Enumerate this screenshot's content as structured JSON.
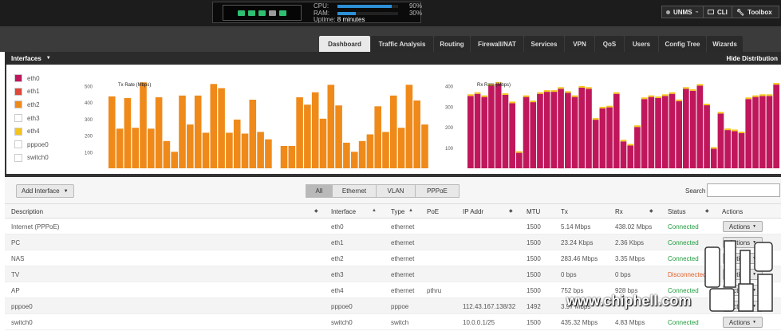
{
  "statusbox": {
    "ports": [
      "green",
      "green",
      "green",
      "grey",
      "green"
    ],
    "cpu_label": "CPU:",
    "cpu_pct": "90%",
    "cpu_value": 0.9,
    "ram_label": "RAM:",
    "ram_pct": "30%",
    "ram_value": 0.3,
    "uptime_label": "Uptime:",
    "uptime_value": "8 minutes"
  },
  "topbuttons": {
    "unms": "UNMS",
    "cli": "CLI",
    "toolbox": "Toolbox"
  },
  "tabs": [
    "Dashboard",
    "Traffic Analysis",
    "Routing",
    "Firewall/NAT",
    "Services",
    "VPN",
    "QoS",
    "Users",
    "Config Tree",
    "Wizards"
  ],
  "interfaces": {
    "title": "Interfaces",
    "hide_distribution": "Hide Distribution"
  },
  "legend": [
    {
      "name": "eth0",
      "color": "#c0175c"
    },
    {
      "name": "eth1",
      "color": "#e0483a"
    },
    {
      "name": "eth2",
      "color": "#ef8a1a"
    },
    {
      "name": "eth3",
      "color": "#ffffff"
    },
    {
      "name": "eth4",
      "color": "#f5c41b"
    },
    {
      "name": "pppoe0",
      "color": "#ffffff"
    },
    {
      "name": "switch0",
      "color": "#ffffff"
    }
  ],
  "chart_data": [
    {
      "type": "bar",
      "title": "Tx Rate (Mbps)",
      "color": "#ef8a1a",
      "ylim": [
        0,
        550
      ],
      "yticks": [
        100,
        200,
        300,
        400,
        500
      ],
      "gaps_after": [
        21
      ],
      "values": [
        435,
        240,
        425,
        245,
        520,
        240,
        430,
        165,
        100,
        440,
        265,
        440,
        215,
        510,
        485,
        215,
        295,
        210,
        415,
        220,
        175,
        0,
        135,
        135,
        430,
        385,
        460,
        300,
        505,
        380,
        155,
        100,
        165,
        205,
        375,
        220,
        440,
        245,
        505,
        410,
        265
      ]
    },
    {
      "type": "bar",
      "title": "Rx Rate (Mbps)",
      "color": "#c0175c",
      "accent": "#f5c41b",
      "ylim": [
        0,
        440
      ],
      "yticks": [
        100,
        200,
        300,
        400
      ],
      "values": [
        350,
        360,
        345,
        400,
        410,
        355,
        315,
        75,
        345,
        320,
        360,
        370,
        370,
        385,
        365,
        345,
        390,
        385,
        235,
        290,
        295,
        360,
        130,
        110,
        200,
        335,
        345,
        340,
        350,
        360,
        325,
        385,
        375,
        400,
        305,
        95,
        265,
        185,
        180,
        170,
        335,
        345,
        350,
        350,
        405
      ]
    }
  ],
  "filters": {
    "add_interface": "Add Interface",
    "segments": [
      "All",
      "Ethernet",
      "VLAN",
      "PPPoE"
    ],
    "search_label": "Search",
    "search_value": ""
  },
  "table": {
    "headers": [
      "Description",
      "Interface",
      "Type",
      "PoE",
      "IP Addr",
      "MTU",
      "Tx",
      "Rx",
      "Status",
      "Actions"
    ],
    "rows": [
      {
        "desc": "Internet (PPPoE)",
        "iface": "eth0",
        "type": "ethernet",
        "poe": "",
        "ip": "",
        "mtu": "1500",
        "tx": "5.14 Mbps",
        "rx": "438.02 Mbps",
        "status": "Connected",
        "action": "Actions"
      },
      {
        "desc": "PC",
        "iface": "eth1",
        "type": "ethernet",
        "poe": "",
        "ip": "",
        "mtu": "1500",
        "tx": "23.24 Kbps",
        "rx": "2.36 Kbps",
        "status": "Connected",
        "action": "Actions"
      },
      {
        "desc": "NAS",
        "iface": "eth2",
        "type": "ethernet",
        "poe": "",
        "ip": "",
        "mtu": "1500",
        "tx": "283.46 Mbps",
        "rx": "3.35 Mbps",
        "status": "Connected",
        "action": "Actions"
      },
      {
        "desc": "TV",
        "iface": "eth3",
        "type": "ethernet",
        "poe": "",
        "ip": "",
        "mtu": "1500",
        "tx": "0 bps",
        "rx": "0 bps",
        "status": "Disconnected",
        "action": "Actions"
      },
      {
        "desc": "AP",
        "iface": "eth4",
        "type": "ethernet",
        "poe": "pthru",
        "ip": "",
        "mtu": "1500",
        "tx": "752 bps",
        "rx": "928 bps",
        "status": "Connected",
        "action": "Actions"
      },
      {
        "desc": "pppoe0",
        "iface": "pppoe0",
        "type": "pppoe",
        "poe": "",
        "ip": "112.43.167.138/32",
        "mtu": "1492",
        "tx": "3.97 Mbps",
        "rx": "",
        "status": "",
        "action": "Actions"
      },
      {
        "desc": "switch0",
        "iface": "switch0",
        "type": "switch",
        "poe": "",
        "ip": "10.0.0.1/25",
        "mtu": "1500",
        "tx": "435.32 Mbps",
        "rx": "4.83 Mbps",
        "status": "Connected",
        "action": "Actions"
      }
    ]
  },
  "watermark": "www.chiphell.com"
}
